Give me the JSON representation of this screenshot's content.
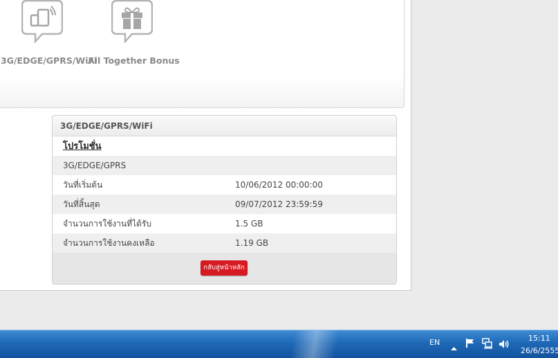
{
  "tiles": [
    {
      "label": "3G/EDGE/GPRS/WiFi",
      "icon": "phone-wifi-icon"
    },
    {
      "label": "All Together Bonus",
      "icon": "gift-icon"
    }
  ],
  "card": {
    "header": "3G/EDGE/GPRS/WiFi",
    "subtitle": "โปรโมชั่น",
    "package": "3G/EDGE/GPRS",
    "rows": [
      {
        "key": "วันที่เริ่มต้น",
        "value": "10/06/2012 00:00:00"
      },
      {
        "key": "วันที่สิ้นสุด",
        "value": "09/07/2012 23:59:59"
      },
      {
        "key": "จำนวนการใช้งานที่ได้รับ",
        "value": "1.5 GB"
      },
      {
        "key": "จำนวนการใช้งานคงเหลือ",
        "value": "1.19 GB"
      }
    ],
    "button_label": "กลับสู่หน้าหลัก"
  },
  "taskbar": {
    "language": "EN",
    "time": "15:11",
    "date": "26/6/2555"
  },
  "colors": {
    "accent_button": "#d61a21",
    "taskbar": "#1f69b7",
    "tile_label": "#8a8a8a"
  }
}
